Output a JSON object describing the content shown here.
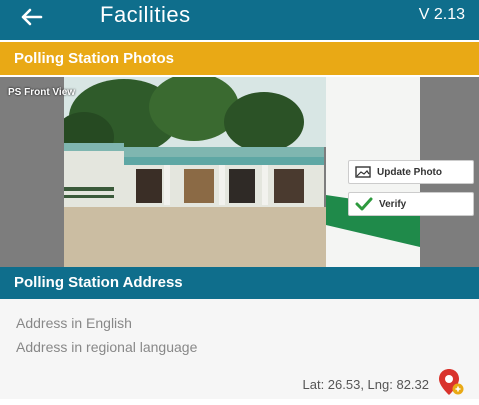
{
  "app": {
    "title": "Facilities",
    "version": "V 2.13"
  },
  "photos_section": {
    "header": "Polling Station Photos",
    "photo_label": "PS Front View",
    "update_label": "Update Photo",
    "verify_label": "Verify",
    "slide_count": 2,
    "active_slide": 1
  },
  "address_section": {
    "header": "Polling Station Address",
    "address_english": "Address in English",
    "address_regional": "Address in regional language",
    "coordinates": "Lat: 26.53, Lng: 82.32"
  },
  "colors": {
    "primary": "#0f6e8c",
    "accent": "#e9a915",
    "verify_check": "#2e9a3e",
    "pin": "#d9332c"
  }
}
